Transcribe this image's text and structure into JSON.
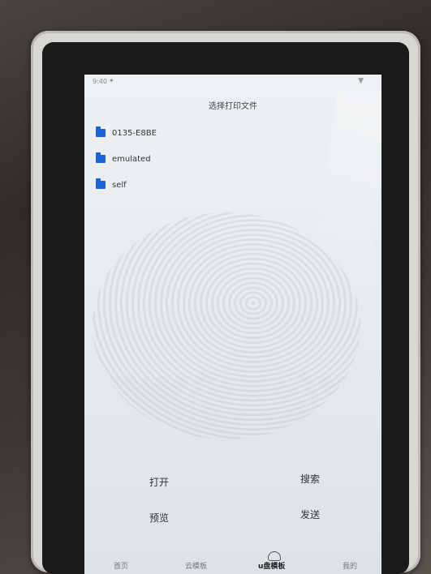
{
  "status_bar": {
    "time": "9:40"
  },
  "header": {
    "title": "选择打印文件"
  },
  "folders": [
    {
      "label": "0135-E8BE"
    },
    {
      "label": "emulated"
    },
    {
      "label": "self"
    }
  ],
  "actions": {
    "open": "打开",
    "search": "搜索",
    "preview": "预览",
    "send": "发送"
  },
  "tabbar": {
    "tabs": [
      {
        "label": "首页"
      },
      {
        "label": "云模板"
      },
      {
        "label": "u盘模板",
        "active": true
      },
      {
        "label": "我的"
      }
    ]
  },
  "icons": {
    "folder": "folder-icon",
    "wifi": "wifi-icon",
    "usb_tab": "cloud-usb-icon"
  },
  "colors": {
    "folder_blue": "#1e63d6"
  }
}
